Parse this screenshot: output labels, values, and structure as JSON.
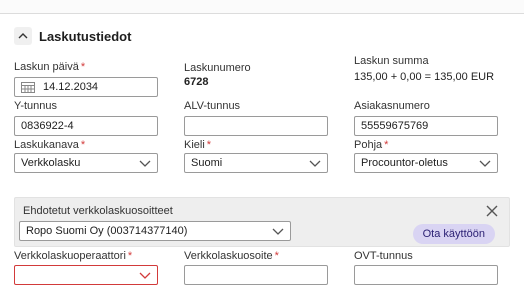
{
  "section": {
    "title": "Laskutustiedot",
    "collapse_icon": "chevron-up-icon"
  },
  "invoice_date": {
    "label": "Laskun päivä",
    "required_mark": "*",
    "value": "14.12.2034",
    "icon": "calendar-icon"
  },
  "invoice_number": {
    "label": "Laskunumero",
    "value": "6728"
  },
  "invoice_total": {
    "label": "Laskun summa",
    "value": "135,00 + 0,00 = 135,00 EUR"
  },
  "business_id": {
    "label": "Y-tunnus",
    "value": "0836922-4"
  },
  "vat_id": {
    "label": "ALV-tunnus",
    "value": ""
  },
  "customer_number": {
    "label": "Asiakasnumero",
    "value": "55559675769"
  },
  "invoice_channel": {
    "label": "Laskukanava",
    "required_mark": "*",
    "value": "Verkkolasku"
  },
  "language": {
    "label": "Kieli",
    "required_mark": "*",
    "value": "Suomi"
  },
  "template": {
    "label": "Pohja",
    "required_mark": "*",
    "value": "Procountor-oletus"
  },
  "suggested": {
    "title": "Ehdotetut verkkolaskuosoitteet",
    "selected": "Ropo Suomi Oy (003714377140)",
    "use_button": "Ota käyttöön",
    "close_icon": "close-icon"
  },
  "operator": {
    "label": "Verkkolaskuoperaattori",
    "required_mark": "*",
    "value": ""
  },
  "einvoice_address": {
    "label": "Verkkolaskuosoite",
    "required_mark": "*",
    "value": ""
  },
  "ovt": {
    "label": "OVT-tunnus",
    "value": ""
  },
  "colors": {
    "error": "#d23a3a",
    "accent_bg": "#d9d4f3",
    "accent_text": "#2d2275"
  }
}
